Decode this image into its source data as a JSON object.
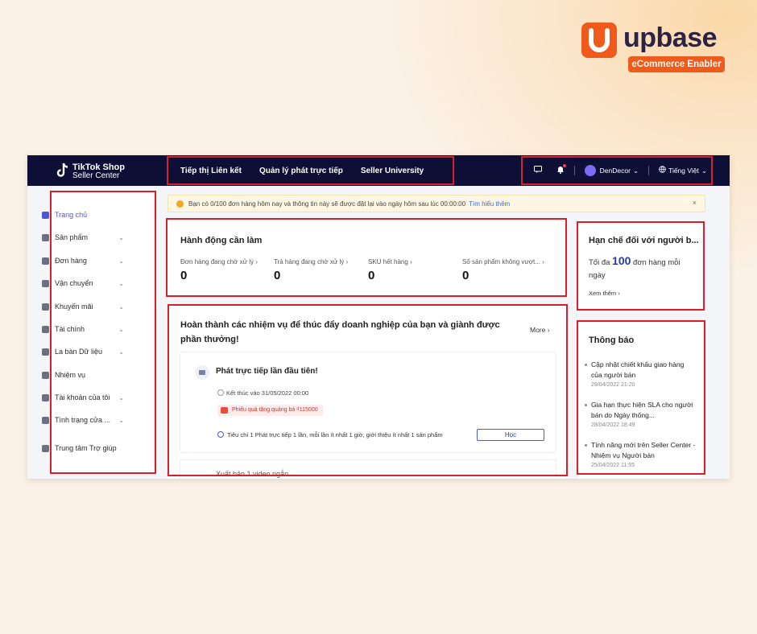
{
  "brand": {
    "name": "upbase",
    "tagline": "eCommerce Enabler",
    "accent": "#f05a1a"
  },
  "header": {
    "logo_line1": "TikTok Shop",
    "logo_line2": "Seller Center",
    "nav": [
      "Tiếp thị Liên kết",
      "Quản lý phát trực tiếp",
      "Seller University"
    ],
    "icons": [
      "chat-icon",
      "bell-icon",
      "globe-icon"
    ],
    "account": "DenDecor",
    "language": "Tiếng Việt"
  },
  "sidebar": {
    "items": [
      {
        "label": "Trang chủ",
        "icon": "home-icon",
        "active": true,
        "expandable": false
      },
      {
        "label": "Sản phẩm",
        "icon": "product-icon",
        "active": false,
        "expandable": true
      },
      {
        "label": "Đơn hàng",
        "icon": "order-icon",
        "active": false,
        "expandable": true
      },
      {
        "label": "Vận chuyển",
        "icon": "shipping-icon",
        "active": false,
        "expandable": true
      },
      {
        "label": "Khuyến mãi",
        "icon": "promo-icon",
        "active": false,
        "expandable": true
      },
      {
        "label": "Tài chính",
        "icon": "finance-icon",
        "active": false,
        "expandable": true
      },
      {
        "label": "La bàn Dữ liệu",
        "icon": "data-icon",
        "active": false,
        "expandable": true
      },
      {
        "label": "Nhiệm vụ",
        "icon": "task-icon",
        "active": false,
        "expandable": false
      },
      {
        "label": "Tài khoản của tôi",
        "icon": "account-icon",
        "active": false,
        "expandable": true
      },
      {
        "label": "Tình trạng cửa ...",
        "icon": "store-status-icon",
        "active": false,
        "expandable": true
      },
      {
        "label": "Trung tâm Trợ giúp",
        "icon": "help-icon",
        "active": false,
        "expandable": false
      }
    ]
  },
  "banner": {
    "text": "Bạn có 0/100 đơn hàng hôm nay và thông tin này sẽ được đặt lại vào ngày hôm sau lúc 00:00:00",
    "link": "Tìm hiểu thêm",
    "close": "×"
  },
  "actions": {
    "title": "Hành động cần làm",
    "metrics": [
      {
        "label": "Đơn hàng đang chờ xử lý",
        "value": "0"
      },
      {
        "label": "Trả hàng đang chờ xử lý",
        "value": "0"
      },
      {
        "label": "SKU hết hàng",
        "value": "0"
      },
      {
        "label": "Số sản phẩm không vượt...",
        "value": "0"
      }
    ]
  },
  "limit": {
    "title": "Hạn chế đối với người b...",
    "prefix": "Tối đa",
    "amount": "100",
    "suffix": "đơn hàng mỗi ngày",
    "more": "Xem thêm"
  },
  "tasks": {
    "title": "Hoàn thành các nhiệm vụ để thúc đẩy doanh nghiệp của bạn và giành được phần thưởng!",
    "more": "More",
    "item": {
      "name": "Phát trực tiếp lần đầu tiên!",
      "deadline": "Kết thúc vào 31/05/2022 00:00",
      "reward": "Phiếu quà tặng quảng bá ₫115000",
      "criteria": "Tiêu chí 1  Phát trực tiếp 1 lần, mỗi lần ít nhất 1 giờ, giới thiệu ít nhất 1 sản phẩm",
      "button": "Học"
    },
    "next_item": "Xuất bản 1 video ngắn"
  },
  "notices": {
    "title": "Thông báo",
    "items": [
      {
        "title": "Cập nhật chiết khấu giao hàng của người bán",
        "date": "29/04/2022 21:20"
      },
      {
        "title": "Gia hạn thực hiện SLA cho người bán do Ngày thống...",
        "date": "28/04/2022 18:49"
      },
      {
        "title": "Tính năng mới trên Seller Center - Nhiệm vụ Người bán",
        "date": "25/04/2022 11:55"
      }
    ]
  }
}
